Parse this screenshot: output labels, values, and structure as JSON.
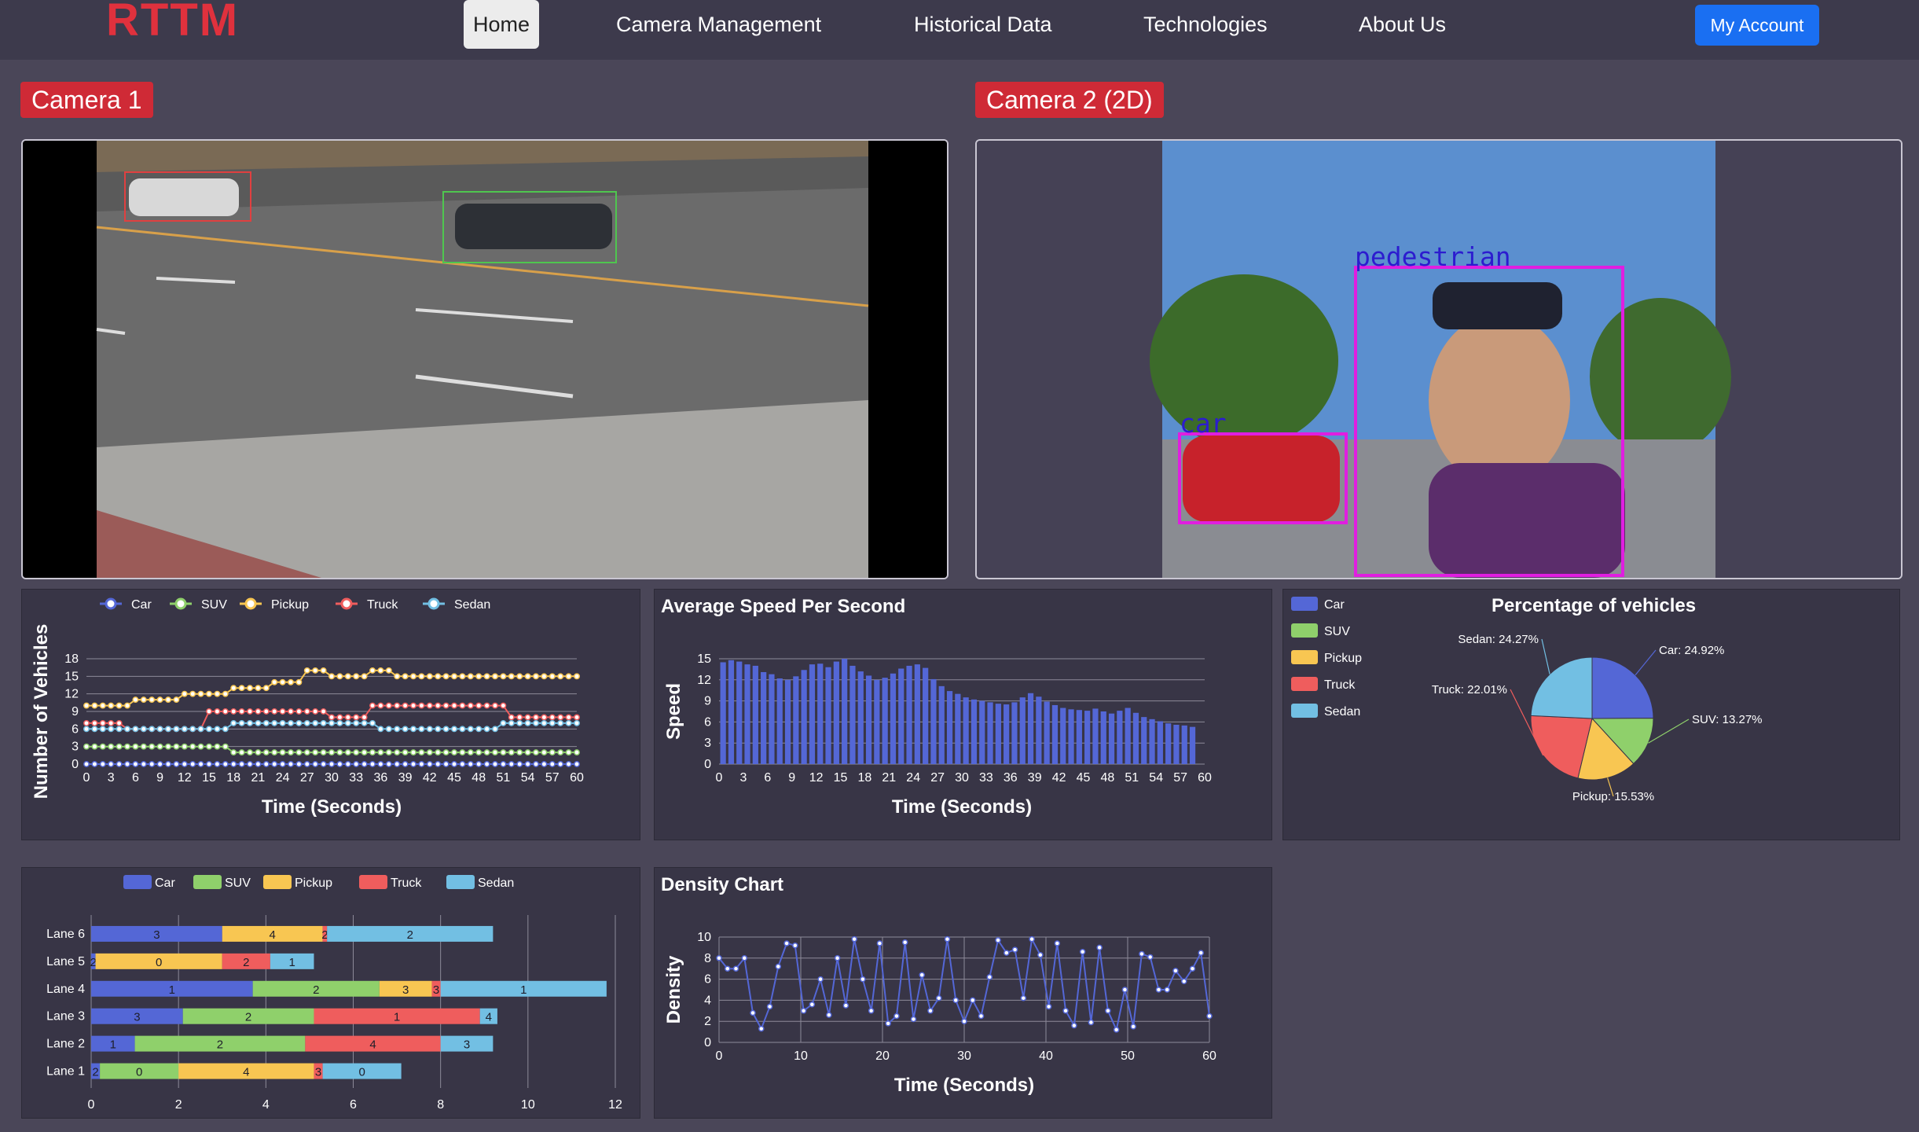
{
  "nav": {
    "logo": "RTTM",
    "items": [
      "Home",
      "Camera Management",
      "Historical Data",
      "Technologies",
      "About Us"
    ],
    "account_label": "My Account"
  },
  "cameras": {
    "cam1_label": "Camera 1",
    "cam2_label": "Camera 2 (2D)",
    "cam2_detections": [
      "pedestrian",
      "car"
    ]
  },
  "colors": {
    "car": "#5467d6",
    "suv": "#8fd06b",
    "pickup": "#f8c652",
    "truck": "#ef5d5d",
    "sedan": "#72bfe3",
    "accent": "#1a6ff2",
    "brand": "#e0313d"
  },
  "vehicle_types": [
    "Car",
    "SUV",
    "Pickup",
    "Truck",
    "Sedan"
  ],
  "chart_data": [
    {
      "type": "line",
      "ylabel": "Number of Vehicles",
      "xlabel": "Time (Seconds)",
      "yticks": [
        0,
        3,
        6,
        9,
        12,
        15,
        18
      ],
      "xticks": [
        0,
        3,
        6,
        9,
        12,
        15,
        18,
        21,
        24,
        27,
        30,
        33,
        36,
        39,
        42,
        45,
        48,
        51,
        54,
        57,
        60
      ],
      "ylim": [
        0,
        18
      ],
      "xlim": [
        0,
        60
      ],
      "grid": "horizontal",
      "legend": "top",
      "series": [
        {
          "name": "Car",
          "segments": [
            [
              0,
              60,
              0
            ]
          ]
        },
        {
          "name": "SUV",
          "segments": [
            [
              0,
              18,
              3
            ],
            [
              18,
              21,
              2
            ],
            [
              21,
              30,
              2
            ],
            [
              30,
              60,
              2
            ]
          ]
        },
        {
          "name": "Pickup",
          "segments": [
            [
              0,
              6,
              10
            ],
            [
              6,
              12,
              11
            ],
            [
              12,
              18,
              12
            ],
            [
              18,
              23,
              13
            ],
            [
              23,
              27,
              14
            ],
            [
              27,
              30,
              16
            ],
            [
              30,
              35,
              15
            ],
            [
              35,
              38,
              16
            ],
            [
              38,
              60,
              15
            ]
          ]
        },
        {
          "name": "Truck",
          "segments": [
            [
              0,
              5,
              7
            ],
            [
              5,
              15,
              6
            ],
            [
              15,
              30,
              9
            ],
            [
              30,
              35,
              8
            ],
            [
              35,
              52,
              10
            ],
            [
              52,
              55,
              8
            ],
            [
              55,
              60,
              8
            ]
          ]
        },
        {
          "name": "Sedan",
          "segments": [
            [
              0,
              12,
              6
            ],
            [
              12,
              18,
              6
            ],
            [
              18,
              21,
              7
            ],
            [
              21,
              36,
              7
            ],
            [
              36,
              51,
              6
            ],
            [
              51,
              54,
              7
            ],
            [
              54,
              60,
              7
            ]
          ]
        }
      ]
    },
    {
      "type": "bar",
      "title": "Average Speed Per Second",
      "ylabel": "Speed",
      "xlabel": "Time (Seconds)",
      "yticks": [
        0,
        3,
        6,
        9,
        12,
        15
      ],
      "xticks": [
        0,
        3,
        6,
        9,
        12,
        15,
        18,
        21,
        24,
        27,
        30,
        33,
        36,
        39,
        42,
        45,
        48,
        51,
        54,
        57,
        60
      ],
      "ylim": [
        0,
        15
      ],
      "values": [
        14.5,
        14.8,
        14.6,
        14.2,
        14.0,
        13.1,
        12.8,
        12.2,
        12.0,
        12.5,
        13.4,
        14.2,
        14.3,
        13.8,
        14.6,
        15.0,
        14.0,
        13.2,
        12.6,
        12.0,
        12.3,
        12.9,
        13.6,
        14.0,
        14.2,
        13.7,
        12.1,
        11.1,
        10.4,
        10.0,
        9.5,
        9.2,
        9.0,
        8.8,
        8.6,
        8.5,
        8.8,
        9.5,
        10.1,
        9.6,
        8.9,
        8.4,
        8.0,
        7.8,
        7.7,
        7.6,
        7.9,
        7.5,
        7.2,
        7.6,
        8.0,
        7.3,
        6.7,
        6.4,
        6.1,
        5.8,
        5.6,
        5.5,
        5.3
      ]
    },
    {
      "type": "pie",
      "title": "Percentage of vehicles",
      "legend": "left",
      "slices": [
        {
          "name": "Car",
          "label": "Car: 24.92%",
          "value": 24.92
        },
        {
          "name": "SUV",
          "label": "SUV: 13.27%",
          "value": 13.27
        },
        {
          "name": "Pickup",
          "label": "Pickup: 15.53%",
          "value": 15.53
        },
        {
          "name": "Truck",
          "label": "Truck: 22.01%",
          "value": 22.01
        },
        {
          "name": "Sedan",
          "label": "Sedan: 24.27%",
          "value": 24.27
        }
      ]
    },
    {
      "type": "bar",
      "orientation": "horizontal-stacked",
      "legend": "top",
      "xticks": [
        0,
        2,
        4,
        6,
        8,
        10,
        12
      ],
      "xlim": [
        0,
        12
      ],
      "categories": [
        "Lane 1",
        "Lane 2",
        "Lane 3",
        "Lane 4",
        "Lane 5",
        "Lane 6"
      ],
      "series": [
        {
          "name": "Car",
          "values": [
            0.2,
            1.0,
            2.1,
            3.7,
            0.1,
            3.0
          ],
          "labels": [
            "2",
            "1",
            "3",
            "1",
            "2",
            "3"
          ]
        },
        {
          "name": "SUV",
          "values": [
            1.8,
            3.9,
            3.0,
            2.9,
            0.0,
            0.0
          ],
          "labels": [
            "0",
            "2",
            "2",
            "2",
            "",
            ""
          ]
        },
        {
          "name": "Pickup",
          "values": [
            3.1,
            0.0,
            0.0,
            1.2,
            2.9,
            2.3
          ],
          "labels": [
            "4",
            "",
            "",
            "3",
            "0",
            "4"
          ]
        },
        {
          "name": "Truck",
          "values": [
            0.2,
            3.1,
            3.8,
            0.2,
            1.1,
            0.1
          ],
          "labels": [
            "3",
            "4",
            "1",
            "3",
            "2",
            "2"
          ]
        },
        {
          "name": "Sedan",
          "values": [
            1.8,
            1.2,
            0.4,
            3.8,
            1.0,
            3.8
          ],
          "labels": [
            "0",
            "3",
            "4",
            "1",
            "1",
            "2"
          ]
        }
      ]
    },
    {
      "type": "line",
      "title": "Density Chart",
      "ylabel": "Density",
      "xlabel": "Time (Seconds)",
      "yticks": [
        0,
        2,
        4,
        6,
        8,
        10
      ],
      "xticks": [
        0,
        10,
        20,
        30,
        40,
        50,
        60
      ],
      "ylim": [
        0,
        10
      ],
      "xlim": [
        0,
        60
      ],
      "grid": "both",
      "values": [
        8.0,
        7.0,
        7.0,
        8.0,
        2.8,
        1.3,
        3.4,
        7.2,
        9.4,
        9.2,
        3.0,
        3.6,
        6.0,
        2.6,
        8.0,
        3.5,
        9.8,
        6.0,
        3.0,
        9.4,
        1.8,
        2.5,
        9.5,
        2.2,
        6.4,
        3.0,
        4.2,
        9.8,
        4.0,
        2.0,
        4.0,
        2.5,
        6.2,
        9.7,
        8.5,
        8.8,
        4.2,
        9.8,
        8.3,
        3.4,
        9.4,
        3.0,
        1.6,
        8.6,
        1.9,
        9.0,
        3.0,
        1.2,
        5.0,
        1.5,
        8.4,
        8.1,
        5.0,
        5.0,
        6.8,
        5.8,
        7.0,
        8.5,
        2.5
      ]
    }
  ]
}
